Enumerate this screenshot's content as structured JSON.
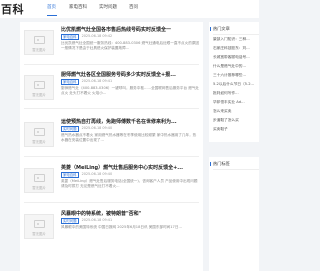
{
  "header": {
    "logo": "百科",
    "nav": [
      "首页",
      "家电百科",
      "实时问题",
      "百问"
    ]
  },
  "posts": [
    {
      "title": "比优凯燃气灶全国各市售后热线号码实时反馈全一",
      "tag": "家电百科",
      "date": "2025-06-18 09:42",
      "excerpt": "比优凯燃气灶全国统一服务热线：400-883-0306 燃气灶通电后灶眼一直不点火的原因 一般情况下是由于灶具熄火保护装置故障...",
      "thumb": "暂无图片"
    },
    {
      "title": "厨师燃气灶各区全国服务号码多少实时反馈全+报...",
      "tag": "家电百科",
      "date": "2025-06-18 09:41",
      "excerpt": "厨师燃气灶（400-883-0306）一键呼叫，服务中枢……全国联网售后服务平台 燃气灶点火 灶头打不着火 火焰小...",
      "thumb": "暂无图片"
    },
    {
      "title": "运使预热自打再线，免跑师傅数千名在世修来利为...",
      "tag": "实时问题",
      "date": "2025-06-18 09:40",
      "excerpt": "燃气热水器点不着火 家用燃气热水器等在冬季使用比较频繁 家中热水器用了几年，热水器在安装位置中出现了...",
      "thumb": "暂无图片"
    },
    {
      "title": "英菱（MeiLing）燃气灶售后服务中心实时反馈全+...",
      "tag": "家电百科",
      "date": "2025-06-18 09:40",
      "excerpt": "英菱（MeiLing）燃气灶售后服务电话(全国统一)，咨询客户人员 产品使用中出现问题请及时拨打 无论是燃气灶打不着火...",
      "thumb": "暂无图片"
    },
    {
      "title": "风暴眼中的特系统，被特朗普\"否和\"",
      "tag": "实时问题",
      "date": "2025-06-18 09:41",
      "excerpt": "风暴眼中的美国特系统 中国日报网 2025年6月18日讯 美国东部时间17日...",
      "thumb": "暂无图片"
    }
  ],
  "sidebar": {
    "hot_title": "热门文章",
    "hot_items": [
      "豪部入门知识：三种...",
      "石家庄科技股东：刘...",
      "长城宽带客服电话号...",
      "什么是燃气灶中的...",
      "三十六计推荐哪些...",
      "5.2以后什么节日（5.2...",
      "批判如何写作...",
      "华邦恒丰实业 Ad...",
      "怎么来买卖",
      "步道鞋了怎么买",
      "买卖鞋子"
    ],
    "tags_title": "热门标签"
  }
}
